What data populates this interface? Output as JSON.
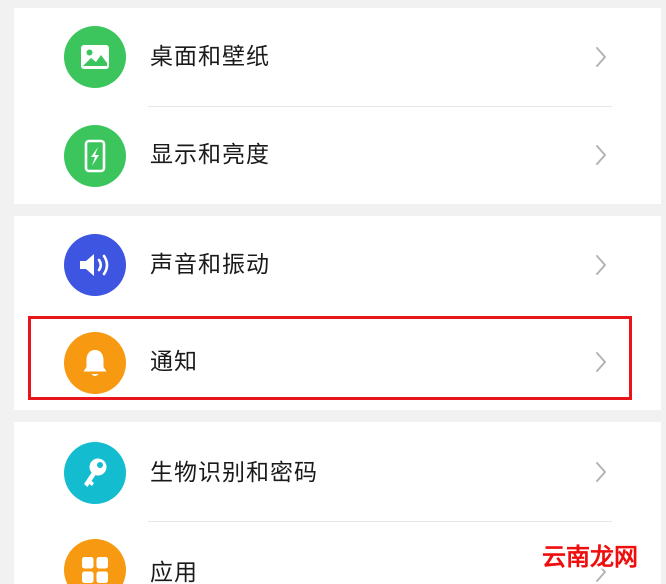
{
  "settings": {
    "items": [
      {
        "label": "桌面和壁纸",
        "icon": "image-icon",
        "color": "#3cc55d"
      },
      {
        "label": "显示和亮度",
        "icon": "phone-brightness-icon",
        "color": "#3cc55d"
      },
      {
        "label": "声音和振动",
        "icon": "speaker-icon",
        "color": "#3d55e0"
      },
      {
        "label": "通知",
        "icon": "bell-icon",
        "color": "#f79a12"
      },
      {
        "label": "生物识别和密码",
        "icon": "key-icon",
        "color": "#13bdcf"
      },
      {
        "label": "应用",
        "icon": "apps-grid-icon",
        "color": "#f79a12"
      }
    ]
  },
  "highlight": {
    "color": "#e8151b",
    "target": "通知"
  },
  "watermark": {
    "text": "云南龙网"
  },
  "colors": {
    "background": "#f1f1f1",
    "card": "#ffffff",
    "chevron": "#b3b3b3"
  }
}
